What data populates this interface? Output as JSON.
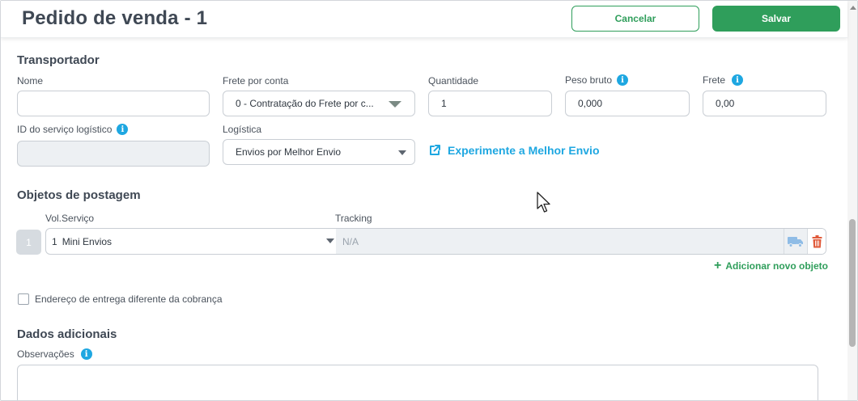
{
  "header": {
    "title": "Pedido de venda - 1",
    "cancel_label": "Cancelar",
    "save_label": "Salvar"
  },
  "transportador": {
    "section_title": "Transportador",
    "nome": {
      "label": "Nome",
      "value": ""
    },
    "frete_por_conta": {
      "label": "Frete por conta",
      "value": "0 - Contratação do Frete por c..."
    },
    "quantidade": {
      "label": "Quantidade",
      "value": "1"
    },
    "peso_bruto": {
      "label": "Peso bruto",
      "value": "0,000"
    },
    "frete": {
      "label": "Frete",
      "value": "0,00"
    },
    "id_servico": {
      "label": "ID do serviço logístico",
      "value": ""
    },
    "logistica": {
      "label": "Logística",
      "value": "Envios por Melhor Envio"
    },
    "experimente_link": "Experimente a Melhor Envio"
  },
  "objetos": {
    "section_title": "Objetos de postagem",
    "col_vol_servico": "Vol.Serviço",
    "col_tracking": "Tracking",
    "items": [
      {
        "index": "1",
        "vol": "1",
        "service": "Mini Envios",
        "tracking": "N/A"
      }
    ],
    "add_label": "Adicionar novo objeto"
  },
  "endereco_checkbox_label": "Endereço de entrega diferente da cobrança",
  "dados_adicionais": {
    "section_title": "Dados adicionais",
    "observacoes_label": "Observações",
    "observacoes_value": ""
  },
  "colors": {
    "primary_green": "#2f9e5b",
    "accent_blue": "#1ea7e1",
    "delete_red": "#e05a3a"
  },
  "icons": [
    "info-icon",
    "external-link-icon",
    "truck-icon",
    "trash-icon",
    "plus-icon",
    "chevron-down-icon"
  ]
}
